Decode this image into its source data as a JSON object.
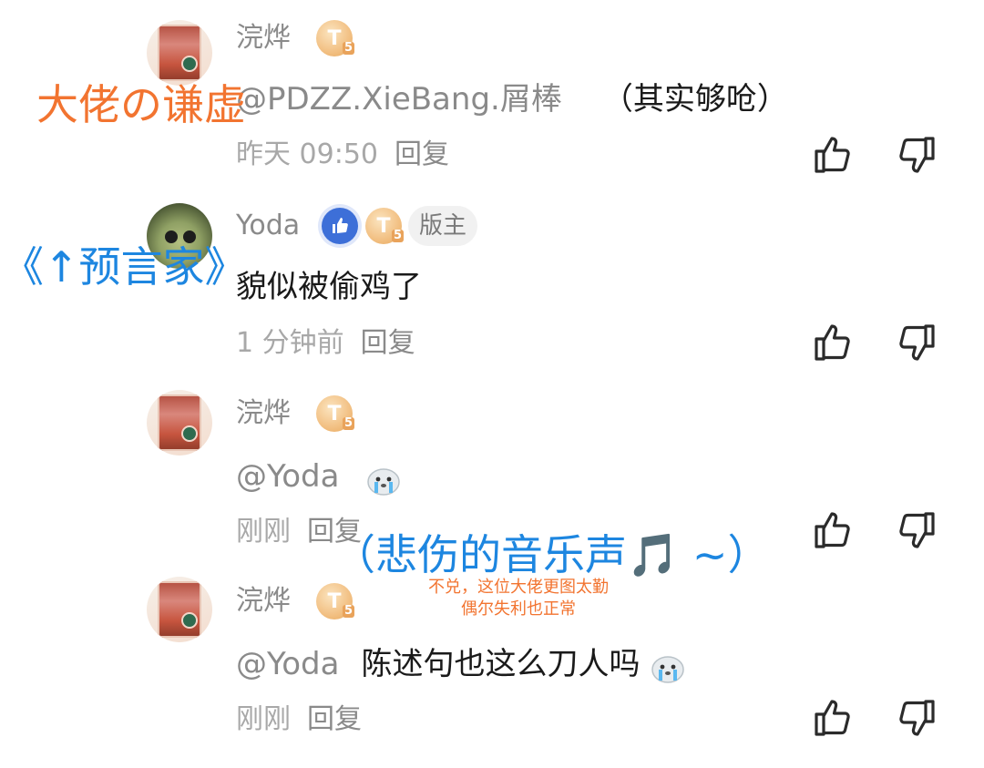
{
  "comments": [
    {
      "username": "浣烨",
      "level": "T",
      "level_num": "5",
      "text_mention": "@PDZZ.XieBang.屑棒",
      "text_extra": "（其实够呛）",
      "time": "昨天 09:50",
      "reply": "回复"
    },
    {
      "username": "Yoda",
      "level": "T",
      "level_num": "5",
      "badge": "版主",
      "text": "貌似被偷鸡了",
      "time": "1 分钟前",
      "reply": "回复"
    },
    {
      "username": "浣烨",
      "level": "T",
      "level_num": "5",
      "text_mention": "@Yoda",
      "time": "刚刚",
      "reply": "回复"
    },
    {
      "username": "浣烨",
      "level": "T",
      "level_num": "5",
      "text_mention": "@Yoda",
      "text": "陈述句也这么刀人吗",
      "time": "刚刚",
      "reply": "回复"
    }
  ],
  "annotations": {
    "humble": "大佬の谦虚",
    "prophet": "《↑预言家》",
    "sad_music": "（悲伤的音乐声🎵 ~）",
    "note_line1": "不兑，这位大佬更图太勤",
    "note_line2": "偶尔失利也正常"
  },
  "colors": {
    "orange": "#f27430",
    "blue": "#1d86e0",
    "badge_gold": "#f2c083",
    "like_blue": "#3d6fd8"
  }
}
